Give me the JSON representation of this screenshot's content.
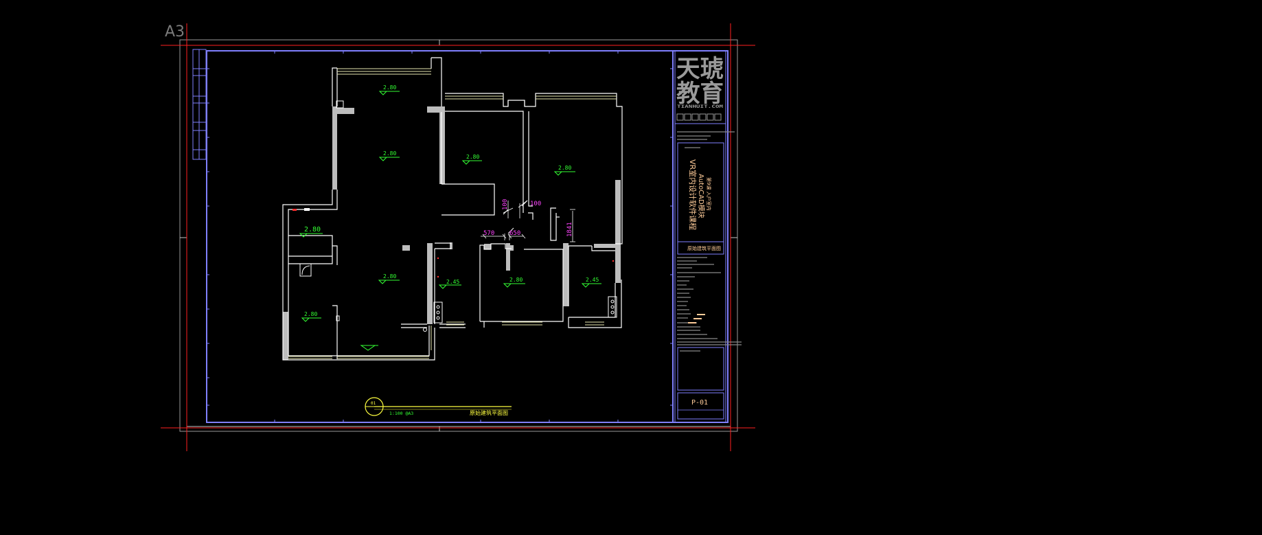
{
  "sheet_size_label": "A3",
  "colors": {
    "background": "#000000",
    "wall": "#ffffff",
    "window": "#e8e8b0",
    "dimension": "#ff44ff",
    "level": "#33ff33",
    "frame": "#8080ff",
    "crosshair": "#ff2020",
    "title_yellow": "#ffff40",
    "logo_gray": "#9a9a9a"
  },
  "plan": {
    "ceiling_levels": [
      "2.80",
      "2.80",
      "2.80",
      "2.80",
      "2.80",
      "2.80",
      "2.45",
      "2.80",
      "2.45",
      "2.80"
    ],
    "dimensions": [
      "100",
      "100",
      "570",
      "650",
      "1841"
    ]
  },
  "drawing_title": {
    "number": "01",
    "scale": "1:100 @A3",
    "name": "原始建筑平面图"
  },
  "title_block": {
    "logo_line1": "天琥",
    "logo_line2": "教育",
    "logo_url": "TIANHUIT.COM",
    "course_line1": "VR室内设计软件课程",
    "course_line2": "AutoCAD模块",
    "course_line3": "第9课 入户室内",
    "drawing_name": "原始建筑平面图",
    "sheet_no": "P-01"
  }
}
